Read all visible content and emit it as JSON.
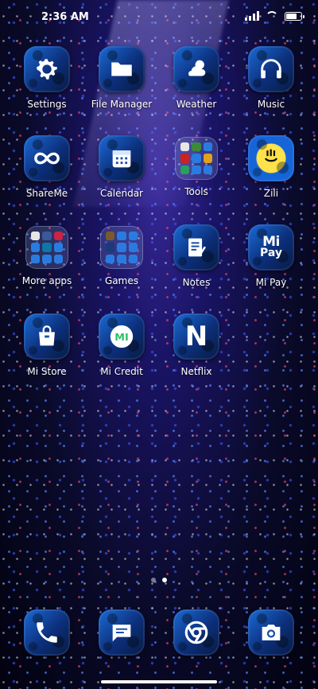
{
  "status_bar": {
    "time": "2:36 AM",
    "battery_level": 0.8
  },
  "apps": [
    {
      "label": "Settings",
      "icon": "gear-icon"
    },
    {
      "label": "File Manager",
      "icon": "folder-icon"
    },
    {
      "label": "Weather",
      "icon": "cloud-sun-icon"
    },
    {
      "label": "Music",
      "icon": "headphones-icon"
    },
    {
      "label": "ShareMe",
      "icon": "infinity-icon"
    },
    {
      "label": "Calendar",
      "icon": "calendar-icon"
    },
    {
      "label": "Tools",
      "icon": "folder-grid-icon"
    },
    {
      "label": "Zili",
      "icon": "zili-face-icon"
    },
    {
      "label": "More apps",
      "icon": "folder-grid-icon"
    },
    {
      "label": "Games",
      "icon": "folder-grid-icon"
    },
    {
      "label": "Notes",
      "icon": "notes-icon"
    },
    {
      "label": "Mi Pay",
      "icon": "mi-pay-icon"
    },
    {
      "label": "Mi Store",
      "icon": "shopping-bag-icon"
    },
    {
      "label": "Mi Credit",
      "icon": "mi-credit-icon"
    },
    {
      "label": "Netflix",
      "icon": "netflix-n-icon"
    }
  ],
  "mipay": {
    "top": "Mi",
    "bottom": "Pay"
  },
  "netflix": {
    "letter": "N"
  },
  "micredit": {
    "letters": "MI"
  },
  "dock": [
    {
      "icon": "phone-icon"
    },
    {
      "icon": "message-icon"
    },
    {
      "icon": "chrome-icon"
    },
    {
      "icon": "camera-icon"
    }
  ],
  "page_indicator": {
    "count": 2,
    "active": 2
  }
}
